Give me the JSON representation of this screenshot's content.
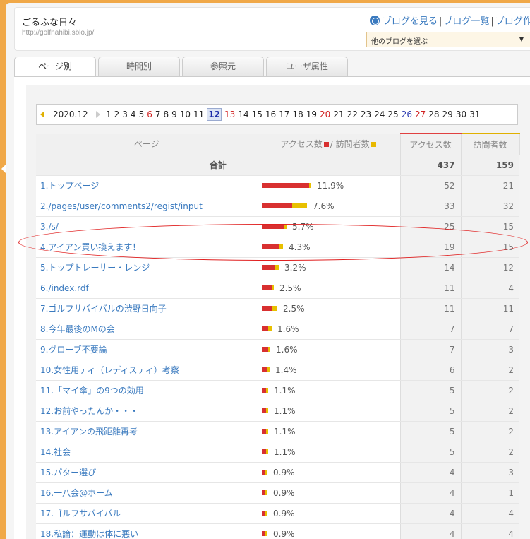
{
  "header": {
    "blog_title": "ごるふな日々",
    "blog_url": "http://golfnahibi.sblo.jp/",
    "links": [
      "ブログを見る",
      "ブログ一覧",
      "ブログ作成"
    ],
    "select_label": "他のブログを選ぶ"
  },
  "tabs": [
    "ページ別",
    "時間別",
    "参照元",
    "ユーザ属性"
  ],
  "active_tab": 0,
  "date_nav": {
    "month": "2020.12",
    "days": [
      "1",
      "2",
      "3",
      "4",
      "5",
      "6",
      "7",
      "8",
      "9",
      "10",
      "11",
      "12",
      "13",
      "14",
      "15",
      "16",
      "17",
      "18",
      "19",
      "20",
      "21",
      "22",
      "23",
      "24",
      "25",
      "26",
      "27",
      "28",
      "29",
      "30",
      "31"
    ],
    "sunday_days": [
      "6",
      "13",
      "20",
      "27"
    ],
    "saturday_days": [
      "26"
    ],
    "selected_day": "12"
  },
  "table": {
    "headers": {
      "page": "ページ",
      "access_visitor": "アクセス数",
      "access_visitor_sep": "/ 訪問者数",
      "access": "アクセス数",
      "visitors": "訪問者数"
    },
    "total": {
      "label": "合計",
      "access": "437",
      "visitors": "159"
    },
    "rows": [
      {
        "page": "1.トップページ",
        "pct": "11.9%",
        "access": "52",
        "visitors": "21",
        "access_frac": 0.119,
        "visitor_frac": 0.132
      },
      {
        "page": "2./pages/user/comments2/regist/input",
        "pct": "7.6%",
        "access": "33",
        "visitors": "32",
        "access_frac": 0.076,
        "visitor_frac": 0.201
      },
      {
        "page": "3./s/",
        "pct": "5.7%",
        "access": "25",
        "visitors": "15",
        "access_frac": 0.057,
        "visitor_frac": 0.094
      },
      {
        "page": "4.アイアン買い換えます！",
        "pct": "4.3%",
        "access": "19",
        "visitors": "15",
        "access_frac": 0.043,
        "visitor_frac": 0.094
      },
      {
        "page": "5.トップトレーサー・レンジ",
        "pct": "3.2%",
        "access": "14",
        "visitors": "12",
        "access_frac": 0.032,
        "visitor_frac": 0.075
      },
      {
        "page": "6./index.rdf",
        "pct": "2.5%",
        "access": "11",
        "visitors": "4",
        "access_frac": 0.025,
        "visitor_frac": 0.025
      },
      {
        "page": "7.ゴルフサバイバルの渋野日向子",
        "pct": "2.5%",
        "access": "11",
        "visitors": "11",
        "access_frac": 0.025,
        "visitor_frac": 0.069
      },
      {
        "page": "8.今年最後のMの会",
        "pct": "1.6%",
        "access": "7",
        "visitors": "7",
        "access_frac": 0.016,
        "visitor_frac": 0.044
      },
      {
        "page": "9.グローブ不要論",
        "pct": "1.6%",
        "access": "7",
        "visitors": "3",
        "access_frac": 0.016,
        "visitor_frac": 0.019
      },
      {
        "page": "10.女性用ティ（レディスティ）考察",
        "pct": "1.4%",
        "access": "6",
        "visitors": "2",
        "access_frac": 0.014,
        "visitor_frac": 0.013
      },
      {
        "page": "11.「マイ傘」の9つの効用",
        "pct": "1.1%",
        "access": "5",
        "visitors": "2",
        "access_frac": 0.011,
        "visitor_frac": 0.013
      },
      {
        "page": "12.お前やったんか・・・",
        "pct": "1.1%",
        "access": "5",
        "visitors": "2",
        "access_frac": 0.011,
        "visitor_frac": 0.013
      },
      {
        "page": "13.アイアンの飛距離再考",
        "pct": "1.1%",
        "access": "5",
        "visitors": "2",
        "access_frac": 0.011,
        "visitor_frac": 0.013
      },
      {
        "page": "14.社会",
        "pct": "1.1%",
        "access": "5",
        "visitors": "2",
        "access_frac": 0.011,
        "visitor_frac": 0.013
      },
      {
        "page": "15.パター選び",
        "pct": "0.9%",
        "access": "4",
        "visitors": "3",
        "access_frac": 0.009,
        "visitor_frac": 0.019
      },
      {
        "page": "16.一八会@ホーム",
        "pct": "0.9%",
        "access": "4",
        "visitors": "1",
        "access_frac": 0.009,
        "visitor_frac": 0.006
      },
      {
        "page": "17.ゴルフサバイバル",
        "pct": "0.9%",
        "access": "4",
        "visitors": "4",
        "access_frac": 0.009,
        "visitor_frac": 0.025
      },
      {
        "page": "18.私論：運動は体に悪い",
        "pct": "0.9%",
        "access": "4",
        "visitors": "4",
        "access_frac": 0.009,
        "visitor_frac": 0.025
      }
    ]
  },
  "highlighted_row": 3,
  "colors": {
    "access_bar": "#d83030",
    "visitor_bar": "#e8b800",
    "link": "#3a7abf",
    "background": "#f0a848"
  }
}
